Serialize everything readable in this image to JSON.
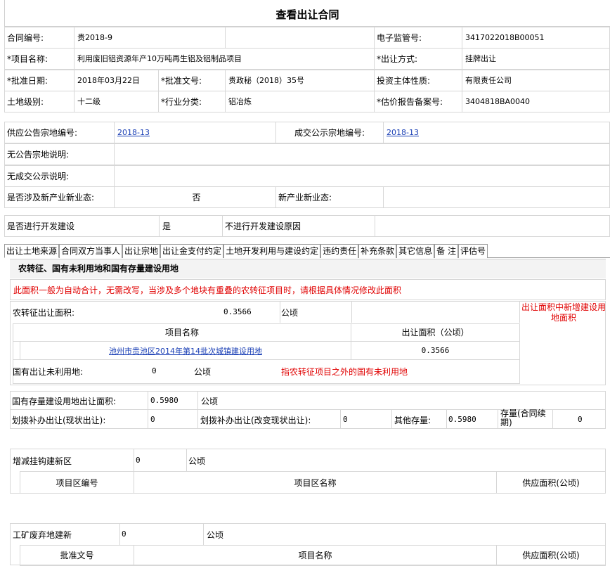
{
  "page_title": "查看出让合同",
  "info": {
    "contract_no_label": "合同编号:",
    "contract_no": "贵2018-9",
    "e_supervision_label": "电子监管号:",
    "e_supervision": "3417022018B00051",
    "project_name_label": "项目名称:",
    "project_name": "利用废旧铝资源年产10万吨再生铝及铝制品项目",
    "transfer_mode_label": "出让方式:",
    "transfer_mode": "挂牌出让",
    "approval_date_label": "批准日期:",
    "approval_date": "2018年03月22日",
    "approval_doc_label": "批准文号:",
    "approval_doc": "贵政秘（2018）35号",
    "investor_type_label": "投资主体性质:",
    "investor_type": "有限责任公司",
    "land_level_label": "土地级别:",
    "land_level": "十二级",
    "industry_label": "行业分类:",
    "industry": "铝冶炼",
    "appraisal_label": "估价报告备案号:",
    "appraisal": "3404818BA0040"
  },
  "supply": {
    "supply_no_label": "供应公告宗地编号:",
    "supply_no": "2018-13",
    "deal_no_label": "成交公示宗地编号:",
    "deal_no": "2018-13",
    "no_notice_label": "无公告宗地说明:",
    "no_deal_label": "无成交公示说明:",
    "new_industry_label": "是否涉及新产业新业态:",
    "new_industry_value": "否",
    "new_industry_type_label": "新产业新业态:",
    "develop_label": "是否进行开发建设",
    "develop_value": "是",
    "no_develop_reason_label": "不进行开发建设原因"
  },
  "tabs": [
    "出让土地来源",
    "合同双方当事人",
    "出让宗地",
    "出让金支付约定",
    "土地开发利用与建设约定",
    "违约责任",
    "补充条款",
    "其它信息",
    "备 注",
    "评估号"
  ],
  "panel": {
    "heading": "农转征、国有未利用地和国有存量建设用地",
    "notice": "此面积一般为自动合计，无需改写，当涉及多个地块有重叠的农转征项目时，请根据具体情况修改此面积",
    "farm_area_label": "农转征出让面积:",
    "farm_area": "0.3566",
    "unit": "公顷",
    "new_build_note": "出让面积中新增建设用地面积",
    "col_project": "项目名称",
    "col_area": "出让面积（公顷）",
    "row_project": "池州市贵池区2014年第14批次城镇建设用地",
    "row_area": "0.3566",
    "unused_label": "国有出让未利用地:",
    "unused_value": "0",
    "unused_note": "指农转征项目之外的国有未利用地",
    "stock_label": "国有存量建设用地出让面积:",
    "stock_value": "0.5980",
    "alloc_status_label": "划拨补办出让(现状出让):",
    "alloc_status_value": "0",
    "alloc_change_label": "划拨补办出让(改变现状出让):",
    "alloc_change_value": "0",
    "other_stock_label": "其他存量:",
    "other_stock_value": "0.5980",
    "renew_label": "存量(合同续期)",
    "renew_value": "0",
    "hook_label": "增减挂钩建新区",
    "hook_value": "0",
    "hook_col1": "项目区编号",
    "hook_col2": "项目区名称",
    "hook_col3": "供应面积(公顷)",
    "mine_label": "工矿废弃地建新",
    "mine_value": "0",
    "mine_col1": "批准文号",
    "mine_col2": "项目名称",
    "mine_col3": "供应面积(公顷)"
  }
}
